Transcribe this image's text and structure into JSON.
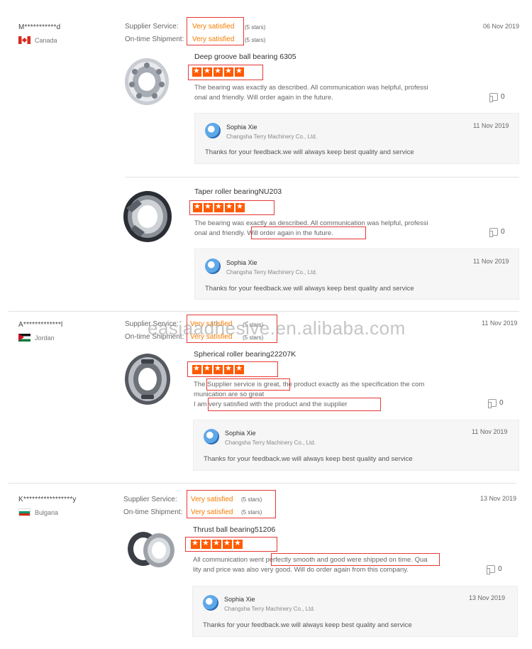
{
  "watermark": "easiaadhesive.en.alibaba.com",
  "reviews": [
    {
      "buyer": "M***********d",
      "country": "Canada",
      "date": "06 Nov 2019",
      "supplier_service_label": "Supplier Service:",
      "supplier_service_value": "Very satisfied",
      "supplier_service_stars": "(5 stars)",
      "ontime_label": "On-time Shipment:",
      "ontime_value": "Very satisfied",
      "ontime_stars": "(5 stars)",
      "items": [
        {
          "product": "Deep groove ball bearing 6305",
          "rating": 5,
          "text_line1": "The bearing was exactly as described. All communication was helpful, professi",
          "text_line2": "onal and friendly. Will order again in the future.",
          "likes": "0",
          "reply": {
            "seller": "Sophia Xie",
            "company": "Changsha Terry Machinery Co., Ltd.",
            "date": "11 Nov 2019",
            "text": "Thanks for your feedback.we will always keep best quality and service"
          }
        },
        {
          "product": "Taper roller bearingNU203",
          "rating": 5,
          "text_line1": "The bearing was exactly as described. All communication was helpful, professi",
          "text_line2a": "onal and friendly.",
          "text_line2b": "Will order again in the future.",
          "likes": "0",
          "reply": {
            "seller": "Sophia Xie",
            "company": "Changsha Terry Machinery Co., Ltd.",
            "date": "11 Nov 2019",
            "text": "Thanks for your feedback.we will always keep best quality and service"
          }
        }
      ]
    },
    {
      "buyer": "A*************l",
      "country": "Jordan",
      "date": "11 Nov 2019",
      "supplier_service_label": "Supplier Service:",
      "supplier_service_value": "Very satisfied",
      "supplier_service_stars": "(5 stars)",
      "ontime_label": "On-time Shipment:",
      "ontime_value": "Very satisfied",
      "ontime_stars": "(5 stars)",
      "items": [
        {
          "product": "Spherical roller bearing22207K",
          "rating": 5,
          "text_line1a": "The",
          "text_line1b": "Supplier service is great,",
          "text_line1c": "the product exactly as the specification the com",
          "text_line2": "munication are so great",
          "text_line3a": "I am",
          "text_line3b": "very satisfied with the product and the supplier",
          "likes": "0",
          "reply": {
            "seller": "Sophia Xie",
            "company": "Changsha Terry Machinery Co., Ltd.",
            "date": "11 Nov 2019",
            "text": "Thanks for your feedback.we will always keep best quality and service"
          }
        }
      ]
    },
    {
      "buyer": "K*****************y",
      "country": "Bulgaria",
      "date": "13 Nov 2019",
      "supplier_service_label": "Supplier Service:",
      "supplier_service_value": "Very satisfied",
      "supplier_service_stars": "(5 stars)",
      "ontime_label": "On-time Shipment:",
      "ontime_value": "Very satisfied",
      "ontime_stars": "(5 stars)",
      "items": [
        {
          "product": "Thrust ball bearing51206",
          "rating": 5,
          "text_line1a": "All communication went",
          "text_line1b": "perfectly smooth and good were shipped on time.",
          "text_line1c": "Qua",
          "text_line2": "lity and price was also very good. Will do order again from this company.",
          "likes": "0",
          "reply": {
            "seller": "Sophia Xie",
            "company": "Changsha Terry Machinery Co., Ltd.",
            "date": "13 Nov 2019",
            "text": "Thanks for your feedback.we will always keep best quality and service"
          }
        }
      ]
    }
  ]
}
